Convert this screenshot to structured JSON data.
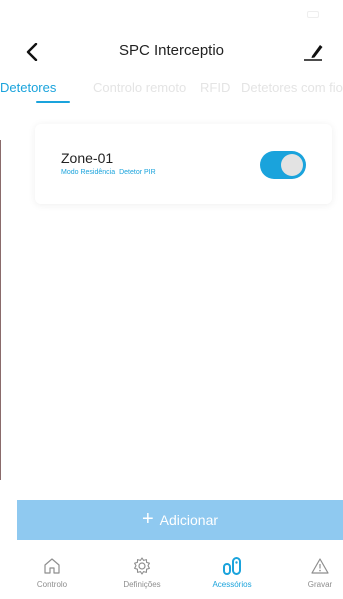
{
  "status_bar": {
    "carrier": "",
    "time": "",
    "battery": ""
  },
  "nav": {
    "title": "SPC Interceptio"
  },
  "tabs": [
    {
      "label": "Detetores",
      "active": true
    },
    {
      "label": "Controlo remoto",
      "active": false
    },
    {
      "label": "RFID",
      "active": false
    },
    {
      "label": "Detetores com fio",
      "active": false
    }
  ],
  "devices": [
    {
      "name": "Zone-01",
      "mode": "Modo Residência",
      "type": "Detetor PIR",
      "enabled": true
    }
  ],
  "add_button": {
    "icon": "plus-icon",
    "label": "Adicionar"
  },
  "bottom_nav": {
    "items": [
      {
        "label": "Controlo",
        "icon": "home-icon",
        "active": false
      },
      {
        "label": "Definições",
        "icon": "gear-icon",
        "active": false
      },
      {
        "label": "Acessórios",
        "icon": "accessories-icon",
        "active": true
      },
      {
        "label": "Gravar",
        "icon": "warning-icon",
        "active": false
      }
    ]
  },
  "colors": {
    "accent": "#1aa3dc",
    "add_button": "#8fc9f0",
    "inactive_tab": "#e4e4e4",
    "inactive_nav": "#8e8e8e"
  }
}
